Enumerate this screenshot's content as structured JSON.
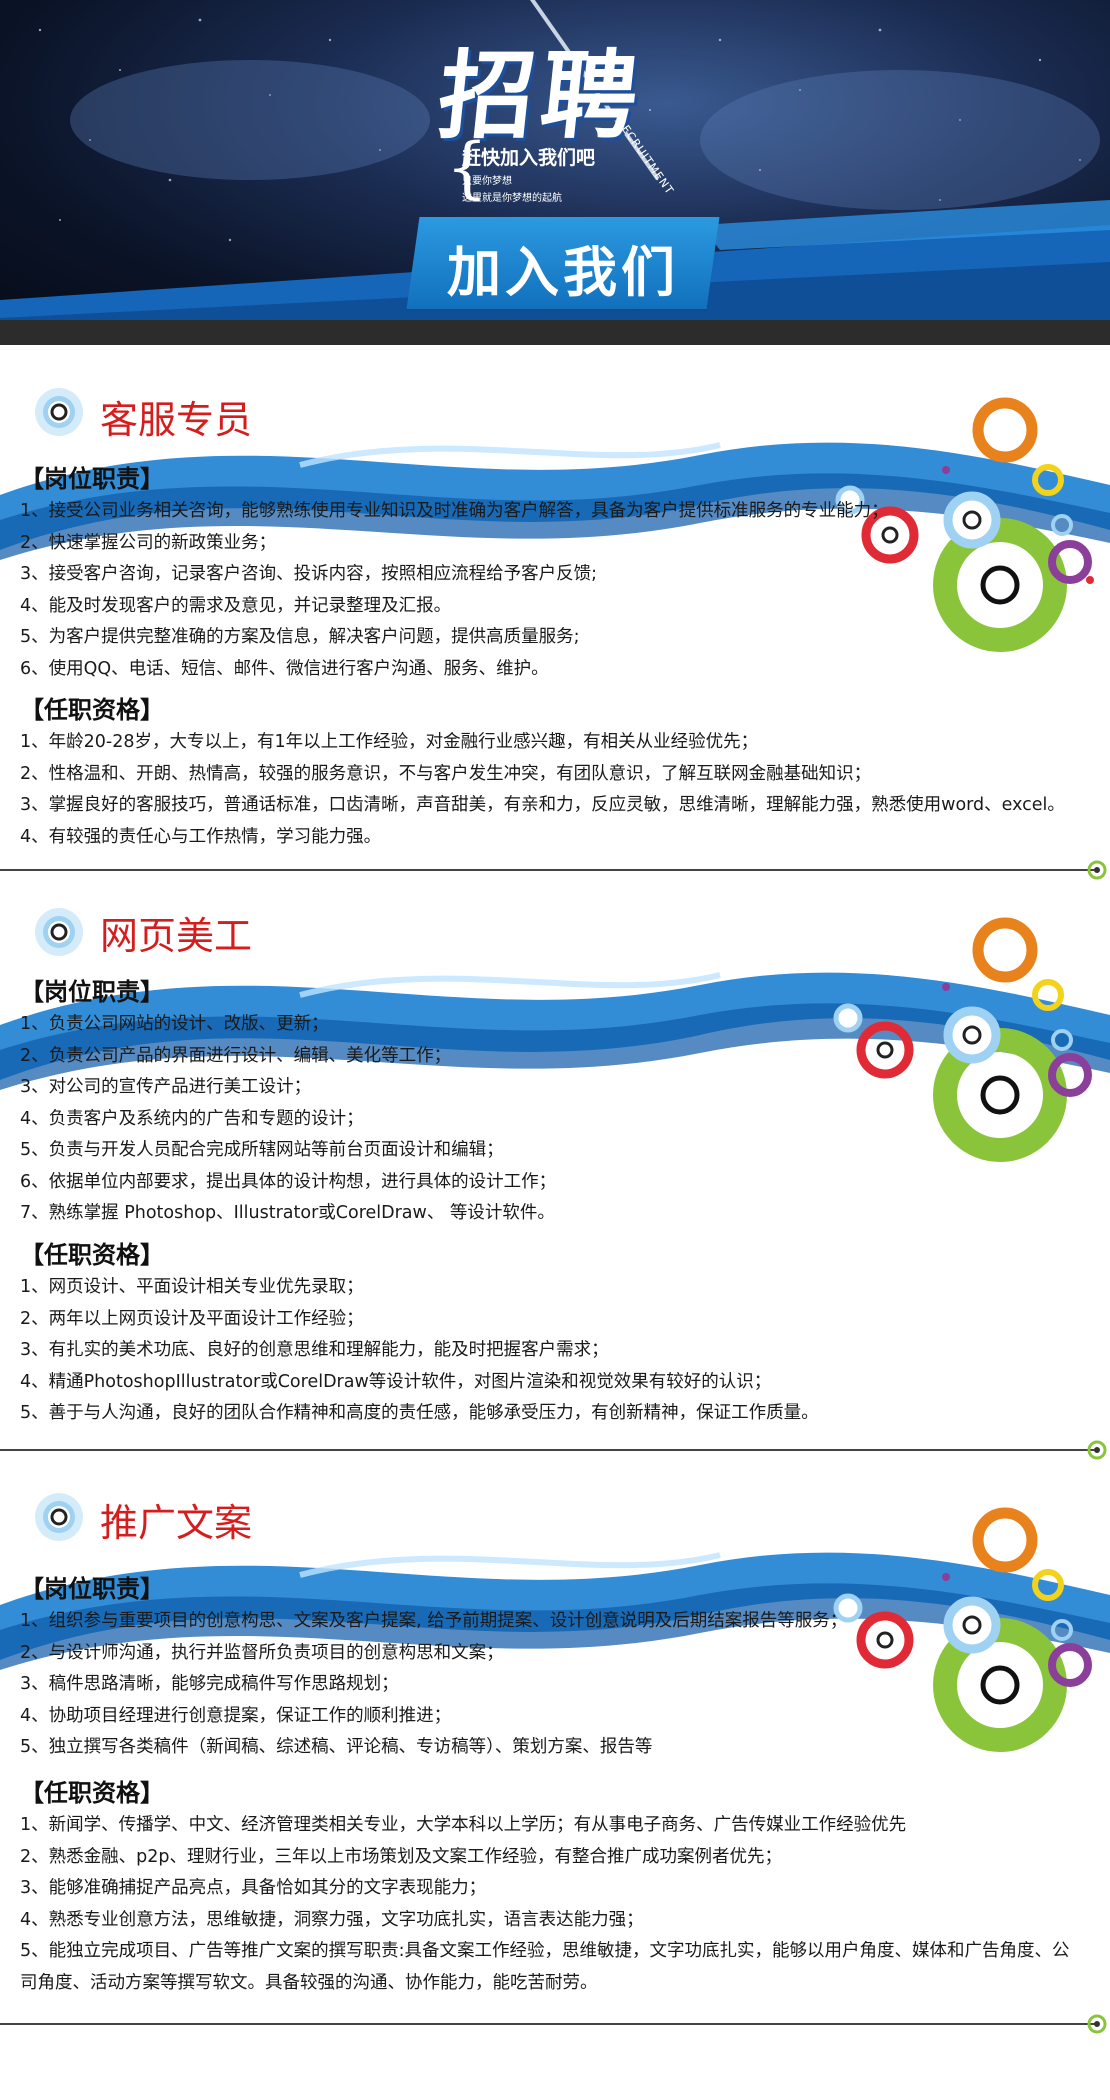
{
  "header": {
    "title": "招聘",
    "subtitle_en": "RECRUITMENT",
    "tagline": "赶快加入我们吧",
    "tagline_line2": "只要你梦想",
    "tagline_line3": "这里就是你梦想的起航",
    "join_label": "加入我们"
  },
  "sections": [
    {
      "title": "客服专员",
      "duties_label": "【岗位职责】",
      "duties": [
        "1、接受公司业务相关咨询，能够熟练使用专业知识及时准确为客户解答，具备为客户提供标准服务的专业能力；",
        "2、快速掌握公司的新政策业务；",
        "3、接受客户咨询，记录客户咨询、投诉内容，按照相应流程给予客户反馈;",
        "4、能及时发现客户的需求及意见，并记录整理及汇报。",
        "5、为客户提供完整准确的方案及信息，解决客户问题，提供高质量服务;",
        "6、使用QQ、电话、短信、邮件、微信进行客户沟通、服务、维护。"
      ],
      "req_label": "【任职资格】",
      "requirements": [
        "1、年龄20-28岁，大专以上，有1年以上工作经验，对金融行业感兴趣，有相关从业经验优先；",
        "2、性格温和、开朗、热情高，较强的服务意识，不与客户发生冲突，有团队意识，了解互联网金融基础知识；",
        "3、掌握良好的客服技巧，普通话标准，口齿清晰，声音甜美，有亲和力，反应灵敏，思维清晰，理解能力强，熟悉使用word、excel。",
        "4、有较强的责任心与工作热情，学习能力强。"
      ]
    },
    {
      "title": "网页美工",
      "duties_label": "【岗位职责】",
      "duties": [
        "1、负责公司网站的设计、改版、更新；",
        "2、负责公司产品的界面进行设计、编辑、美化等工作；",
        "3、对公司的宣传产品进行美工设计；",
        "4、负责客户及系统内的广告和专题的设计；",
        "5、负责与开发人员配合完成所辖网站等前台页面设计和编辑；",
        "6、依据单位内部要求，提出具体的设计构想，进行具体的设计工作；",
        "7、熟练掌握 Photoshop、Illustrator或CorelDraw、 等设计软件。"
      ],
      "req_label": "【任职资格】",
      "requirements": [
        "1、网页设计、平面设计相关专业优先录取；",
        "2、两年以上网页设计及平面设计工作经验；",
        "3、有扎实的美术功底、良好的创意思维和理解能力，能及时把握客户需求；",
        "4、精通PhotoshopIllustrator或CorelDraw等设计软件，对图片渲染和视觉效果有较好的认识；",
        "5、善于与人沟通，良好的团队合作精神和高度的责任感，能够承受压力，有创新精神，保证工作质量。"
      ]
    },
    {
      "title": "推广文案",
      "duties_label": "【岗位职责】",
      "duties": [
        "1、组织参与重要项目的创意构思、文案及客户提案, 给予前期提案、设计创意说明及后期结案报告等服务；",
        "2、与设计师沟通，执行并监督所负责项目的创意构思和文案；",
        "3、稿件思路清晰，能够完成稿件写作思路规划；",
        "4、协助项目经理进行创意提案，保证工作的顺利推进；",
        "5、独立撰写各类稿件（新闻稿、综述稿、评论稿、专访稿等）、策划方案、报告等"
      ],
      "req_label": "【任职资格】",
      "requirements": [
        "1、新闻学、传播学、中文、经济管理类相关专业，大学本科以上学历；有从事电子商务、广告传媒业工作经验优先",
        "2、熟悉金融、p2p、理财行业，三年以上市场策划及文案工作经验，有整合推广成功案例者优先；",
        "3、能够准确捕捉产品亮点，具备恰如其分的文字表现能力；",
        "4、熟悉专业创意方法，思维敏捷，洞察力强，文字功底扎实，语言表达能力强；",
        "5、能独立完成项目、广告等推广文案的撰写职责:具备文案工作经验，思维敏捷，文字功底扎实，能够以用户角度、媒体和广告角度、公司角度、活动方案等撰写软文。具备较强的沟通、协作能力，能吃苦耐劳。"
      ]
    }
  ],
  "colors": {
    "title_red": "#d51d1d",
    "wave_blue": "#1c7fd1",
    "ring_orange": "#e8821c",
    "ring_green": "#8ac43a",
    "ring_red": "#e02a36",
    "ring_purple": "#8b3e9a",
    "ring_yellow": "#f2d21b"
  }
}
